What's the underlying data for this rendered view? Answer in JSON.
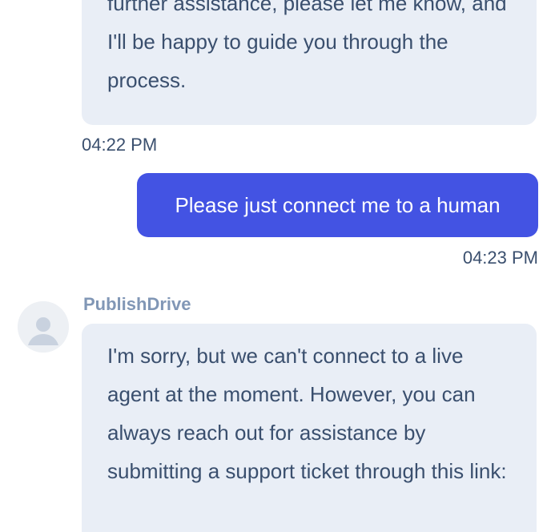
{
  "messages": {
    "bot_previous": {
      "text": "further assistance, please let me know, and I'll be happy to guide you through the process.",
      "time": "04:22 PM"
    },
    "user": {
      "text": "Please just connect me to a human",
      "time": "04:23 PM"
    },
    "bot_reply": {
      "sender": "PublishDrive",
      "avatar_icon": "user-avatar-icon",
      "text": "I'm sorry, but we can't connect to a live agent at the moment. However, you can always reach out for assistance by submitting a support ticket through this link:"
    }
  },
  "colors": {
    "bot_bubble": "#e9eef6",
    "user_bubble": "#4353e3",
    "text": "#3a4f6e",
    "sender": "#8197b6"
  }
}
